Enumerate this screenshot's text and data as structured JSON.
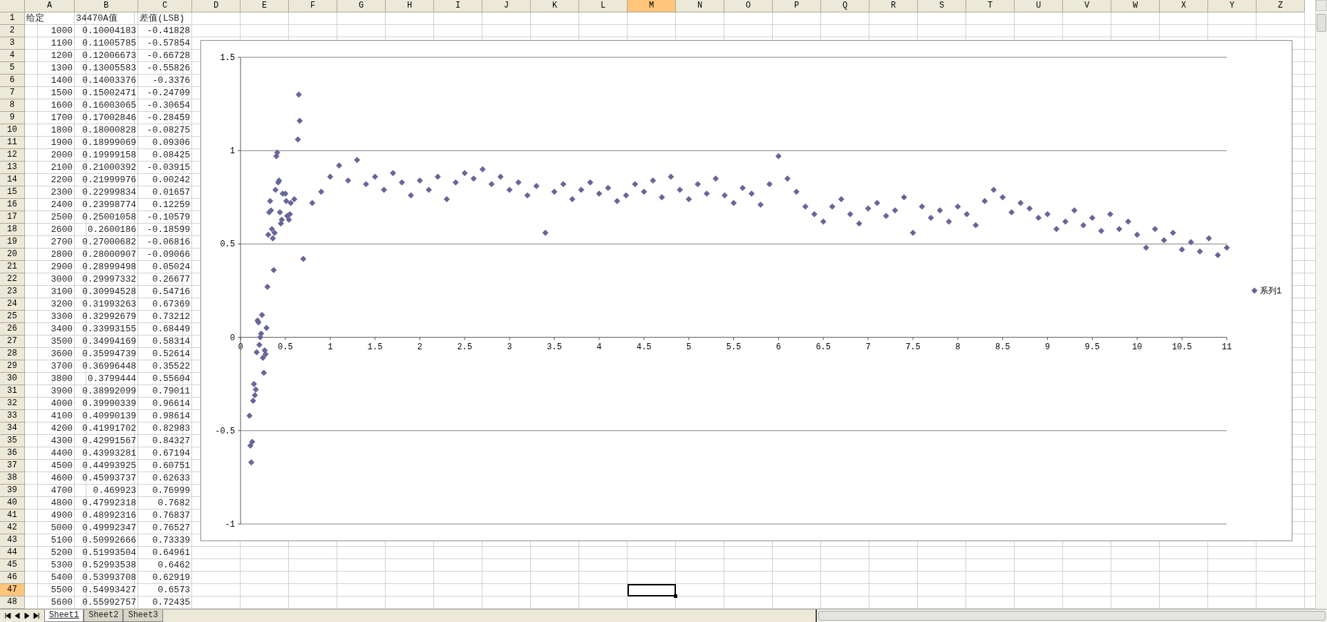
{
  "sheet": {
    "columns": [
      {
        "label": "A",
        "selected": false
      },
      {
        "label": "B",
        "selected": false
      },
      {
        "label": "C",
        "selected": false
      },
      {
        "label": "D",
        "selected": false
      },
      {
        "label": "E",
        "selected": false
      },
      {
        "label": "F",
        "selected": false
      },
      {
        "label": "G",
        "selected": false
      },
      {
        "label": "H",
        "selected": false
      },
      {
        "label": "I",
        "selected": false
      },
      {
        "label": "J",
        "selected": false
      },
      {
        "label": "K",
        "selected": false
      },
      {
        "label": "L",
        "selected": false
      },
      {
        "label": "M",
        "selected": true
      },
      {
        "label": "N",
        "selected": false
      },
      {
        "label": "O",
        "selected": false
      },
      {
        "label": "P",
        "selected": false
      },
      {
        "label": "Q",
        "selected": false
      },
      {
        "label": "R",
        "selected": false
      },
      {
        "label": "S",
        "selected": false
      },
      {
        "label": "T",
        "selected": false
      },
      {
        "label": "U",
        "selected": false
      },
      {
        "label": "V",
        "selected": false
      },
      {
        "label": "W",
        "selected": false
      },
      {
        "label": "X",
        "selected": false
      },
      {
        "label": "Y",
        "selected": false
      },
      {
        "label": "Z",
        "selected": false
      }
    ],
    "rows": [
      {
        "label": "1",
        "kind": "header",
        "selected": false,
        "cells": [
          "给定",
          "34470A值",
          "差值(LSB)"
        ]
      },
      {
        "label": "2",
        "kind": "data",
        "selected": false,
        "cells": [
          "1000",
          "0.10004183",
          "-0.41828"
        ]
      },
      {
        "label": "3",
        "kind": "data",
        "selected": false,
        "cells": [
          "1100",
          "0.11005785",
          "-0.57854"
        ]
      },
      {
        "label": "4",
        "kind": "data",
        "selected": false,
        "cells": [
          "1200",
          "0.12006673",
          "-0.66728"
        ]
      },
      {
        "label": "5",
        "kind": "data",
        "selected": false,
        "cells": [
          "1300",
          "0.13005583",
          "-0.55826"
        ]
      },
      {
        "label": "6",
        "kind": "data",
        "selected": false,
        "cells": [
          "1400",
          "0.14003376",
          "-0.3376"
        ]
      },
      {
        "label": "7",
        "kind": "data",
        "selected": false,
        "cells": [
          "1500",
          "0.15002471",
          "-0.24709"
        ]
      },
      {
        "label": "8",
        "kind": "data",
        "selected": false,
        "cells": [
          "1600",
          "0.16003065",
          "-0.30654"
        ]
      },
      {
        "label": "9",
        "kind": "data",
        "selected": false,
        "cells": [
          "1700",
          "0.17002846",
          "-0.28459"
        ]
      },
      {
        "label": "10",
        "kind": "data",
        "selected": false,
        "cells": [
          "1800",
          "0.18000828",
          "-0.08275"
        ]
      },
      {
        "label": "11",
        "kind": "data",
        "selected": false,
        "cells": [
          "1900",
          "0.18999069",
          "0.09306"
        ]
      },
      {
        "label": "12",
        "kind": "data",
        "selected": false,
        "cells": [
          "2000",
          "0.19999158",
          "0.08425"
        ]
      },
      {
        "label": "13",
        "kind": "data",
        "selected": false,
        "cells": [
          "2100",
          "0.21000392",
          "-0.03915"
        ]
      },
      {
        "label": "14",
        "kind": "data",
        "selected": false,
        "cells": [
          "2200",
          "0.21999976",
          "0.00242"
        ]
      },
      {
        "label": "15",
        "kind": "data",
        "selected": false,
        "cells": [
          "2300",
          "0.22999834",
          "0.01657"
        ]
      },
      {
        "label": "16",
        "kind": "data",
        "selected": false,
        "cells": [
          "2400",
          "0.23998774",
          "0.12259"
        ]
      },
      {
        "label": "17",
        "kind": "data",
        "selected": false,
        "cells": [
          "2500",
          "0.25001058",
          "-0.10579"
        ]
      },
      {
        "label": "18",
        "kind": "data",
        "selected": false,
        "cells": [
          "2600",
          "0.2600186",
          "-0.18599"
        ]
      },
      {
        "label": "19",
        "kind": "data",
        "selected": false,
        "cells": [
          "2700",
          "0.27000682",
          "-0.06816"
        ]
      },
      {
        "label": "20",
        "kind": "data",
        "selected": false,
        "cells": [
          "2800",
          "0.28000907",
          "-0.09066"
        ]
      },
      {
        "label": "21",
        "kind": "data",
        "selected": false,
        "cells": [
          "2900",
          "0.28999498",
          "0.05024"
        ]
      },
      {
        "label": "22",
        "kind": "data",
        "selected": false,
        "cells": [
          "3000",
          "0.29997332",
          "0.26677"
        ]
      },
      {
        "label": "23",
        "kind": "data",
        "selected": false,
        "cells": [
          "3100",
          "0.30994528",
          "0.54716"
        ]
      },
      {
        "label": "24",
        "kind": "data",
        "selected": false,
        "cells": [
          "3200",
          "0.31993263",
          "0.67369"
        ]
      },
      {
        "label": "25",
        "kind": "data",
        "selected": false,
        "cells": [
          "3300",
          "0.32992679",
          "0.73212"
        ]
      },
      {
        "label": "26",
        "kind": "data",
        "selected": false,
        "cells": [
          "3400",
          "0.33993155",
          "0.68449"
        ]
      },
      {
        "label": "27",
        "kind": "data",
        "selected": false,
        "cells": [
          "3500",
          "0.34994169",
          "0.58314"
        ]
      },
      {
        "label": "28",
        "kind": "data",
        "selected": false,
        "cells": [
          "3600",
          "0.35994739",
          "0.52614"
        ]
      },
      {
        "label": "29",
        "kind": "data",
        "selected": false,
        "cells": [
          "3700",
          "0.36996448",
          "0.35522"
        ]
      },
      {
        "label": "30",
        "kind": "data",
        "selected": false,
        "cells": [
          "3800",
          "0.3799444",
          "0.55604"
        ]
      },
      {
        "label": "31",
        "kind": "data",
        "selected": false,
        "cells": [
          "3900",
          "0.38992099",
          "0.79011"
        ]
      },
      {
        "label": "32",
        "kind": "data",
        "selected": false,
        "cells": [
          "4000",
          "0.39990339",
          "0.96614"
        ]
      },
      {
        "label": "33",
        "kind": "data",
        "selected": false,
        "cells": [
          "4100",
          "0.40990139",
          "0.98614"
        ]
      },
      {
        "label": "34",
        "kind": "data",
        "selected": false,
        "cells": [
          "4200",
          "0.41991702",
          "0.82983"
        ]
      },
      {
        "label": "35",
        "kind": "data",
        "selected": false,
        "cells": [
          "4300",
          "0.42991567",
          "0.84327"
        ]
      },
      {
        "label": "36",
        "kind": "data",
        "selected": false,
        "cells": [
          "4400",
          "0.43993281",
          "0.67194"
        ]
      },
      {
        "label": "37",
        "kind": "data",
        "selected": false,
        "cells": [
          "4500",
          "0.44993925",
          "0.60751"
        ]
      },
      {
        "label": "38",
        "kind": "data",
        "selected": false,
        "cells": [
          "4600",
          "0.45993737",
          "0.62633"
        ]
      },
      {
        "label": "39",
        "kind": "data",
        "selected": false,
        "cells": [
          "4700",
          "0.469923",
          "0.76999"
        ]
      },
      {
        "label": "40",
        "kind": "data",
        "selected": false,
        "cells": [
          "4800",
          "0.47992318",
          "0.7682"
        ]
      },
      {
        "label": "41",
        "kind": "data",
        "selected": false,
        "cells": [
          "4900",
          "0.48992316",
          "0.76837"
        ]
      },
      {
        "label": "42",
        "kind": "data",
        "selected": false,
        "cells": [
          "5000",
          "0.49992347",
          "0.76527"
        ]
      },
      {
        "label": "43",
        "kind": "data",
        "selected": false,
        "cells": [
          "5100",
          "0.50992666",
          "0.73339"
        ]
      },
      {
        "label": "44",
        "kind": "data",
        "selected": false,
        "cells": [
          "5200",
          "0.51993504",
          "0.64961"
        ]
      },
      {
        "label": "45",
        "kind": "data",
        "selected": false,
        "cells": [
          "5300",
          "0.52993538",
          "0.6462"
        ]
      },
      {
        "label": "46",
        "kind": "data",
        "selected": false,
        "cells": [
          "5400",
          "0.53993708",
          "0.62919"
        ]
      },
      {
        "label": "47",
        "kind": "data",
        "selected": true,
        "cells": [
          "5500",
          "0.54993427",
          "0.6573"
        ]
      },
      {
        "label": "48",
        "kind": "data",
        "selected": false,
        "cells": [
          "5600",
          "0.55992757",
          "0.72435"
        ]
      }
    ]
  },
  "chart": {
    "chart_data": {
      "type": "scatter",
      "grid": true,
      "xlim": [
        0,
        11
      ],
      "ylim": [
        -1,
        1.5
      ],
      "xticks": [
        0,
        0.5,
        1,
        1.5,
        2,
        2.5,
        3,
        3.5,
        4,
        4.5,
        5,
        5.5,
        6,
        6.5,
        7,
        7.5,
        8,
        8.5,
        9,
        9.5,
        10,
        10.5,
        11
      ],
      "yticks": [
        -1,
        -0.5,
        0,
        0.5,
        1,
        1.5
      ],
      "x": [
        0.1,
        0.11,
        0.12,
        0.13,
        0.14,
        0.15,
        0.16,
        0.17,
        0.18,
        0.19,
        0.2,
        0.21,
        0.22,
        0.23,
        0.24,
        0.25,
        0.26,
        0.27,
        0.28,
        0.29,
        0.3,
        0.31,
        0.32,
        0.33,
        0.34,
        0.35,
        0.36,
        0.37,
        0.38,
        0.39,
        0.4,
        0.41,
        0.42,
        0.43,
        0.44,
        0.45,
        0.46,
        0.47,
        0.5,
        0.51,
        0.52,
        0.54,
        0.55,
        0.56,
        0.6,
        0.64,
        0.65,
        0.66,
        0.7,
        0.8,
        0.9,
        1.0,
        1.1,
        1.2,
        1.3,
        1.4,
        1.5,
        1.6,
        1.7,
        1.8,
        1.9,
        2.0,
        2.1,
        2.2,
        2.3,
        2.4,
        2.5,
        2.6,
        2.7,
        2.8,
        2.9,
        3.0,
        3.1,
        3.2,
        3.3,
        3.4,
        3.5,
        3.6,
        3.7,
        3.8,
        3.9,
        4.0,
        4.1,
        4.2,
        4.3,
        4.4,
        4.5,
        4.6,
        4.7,
        4.8,
        4.9,
        5.0,
        5.1,
        5.2,
        5.3,
        5.4,
        5.5,
        5.6,
        5.7,
        5.8,
        5.9,
        6.0,
        6.1,
        6.2,
        6.3,
        6.4,
        6.5,
        6.6,
        6.7,
        6.8,
        6.9,
        7.0,
        7.1,
        7.2,
        7.3,
        7.4,
        7.5,
        7.6,
        7.7,
        7.8,
        7.9,
        8.0,
        8.1,
        8.2,
        8.3,
        8.4,
        8.5,
        8.6,
        8.7,
        8.8,
        8.9,
        9.0,
        9.1,
        9.2,
        9.3,
        9.4,
        9.5,
        9.6,
        9.7,
        9.8,
        9.9,
        10.0,
        10.1,
        10.2,
        10.3,
        10.4,
        10.5,
        10.6,
        10.7,
        10.8,
        10.9,
        11.0
      ],
      "series": [
        {
          "name": "系列1",
          "color": "#666699",
          "values": [
            -0.42,
            -0.58,
            -0.67,
            -0.56,
            -0.34,
            -0.25,
            -0.31,
            -0.28,
            -0.08,
            0.09,
            0.08,
            -0.04,
            0,
            0.02,
            0.12,
            -0.11,
            -0.19,
            -0.07,
            -0.09,
            0.05,
            0.27,
            0.55,
            0.67,
            0.73,
            0.68,
            0.58,
            0.53,
            0.36,
            0.56,
            0.79,
            0.97,
            0.99,
            0.83,
            0.84,
            0.67,
            0.61,
            0.63,
            0.77,
            0.77,
            0.73,
            0.65,
            0.63,
            0.66,
            0.72,
            0.74,
            1.06,
            1.3,
            1.16,
            0.42,
            0.72,
            0.78,
            0.86,
            0.92,
            0.84,
            0.95,
            0.82,
            0.86,
            0.79,
            0.88,
            0.83,
            0.76,
            0.84,
            0.79,
            0.86,
            0.74,
            0.83,
            0.88,
            0.85,
            0.9,
            0.82,
            0.86,
            0.79,
            0.83,
            0.76,
            0.81,
            0.56,
            0.78,
            0.82,
            0.74,
            0.79,
            0.83,
            0.77,
            0.8,
            0.73,
            0.76,
            0.82,
            0.78,
            0.84,
            0.75,
            0.86,
            0.79,
            0.74,
            0.82,
            0.77,
            0.85,
            0.76,
            0.72,
            0.8,
            0.77,
            0.71,
            0.82,
            0.97,
            0.85,
            0.78,
            0.7,
            0.66,
            0.62,
            0.7,
            0.74,
            0.66,
            0.61,
            0.69,
            0.72,
            0.65,
            0.68,
            0.75,
            0.56,
            0.7,
            0.64,
            0.68,
            0.62,
            0.7,
            0.66,
            0.6,
            0.73,
            0.79,
            0.75,
            0.67,
            0.72,
            0.69,
            0.64,
            0.66,
            0.58,
            0.62,
            0.68,
            0.6,
            0.64,
            0.57,
            0.66,
            0.58,
            0.62,
            0.55,
            0.48,
            0.58,
            0.52,
            0.56,
            0.47,
            0.51,
            0.46,
            0.53,
            0.44,
            0.48
          ]
        }
      ]
    }
  },
  "sheet_tabs": [
    {
      "label": "Sheet1",
      "selected": true
    },
    {
      "label": "Sheet2",
      "selected": false
    },
    {
      "label": "Sheet3",
      "selected": false
    }
  ]
}
